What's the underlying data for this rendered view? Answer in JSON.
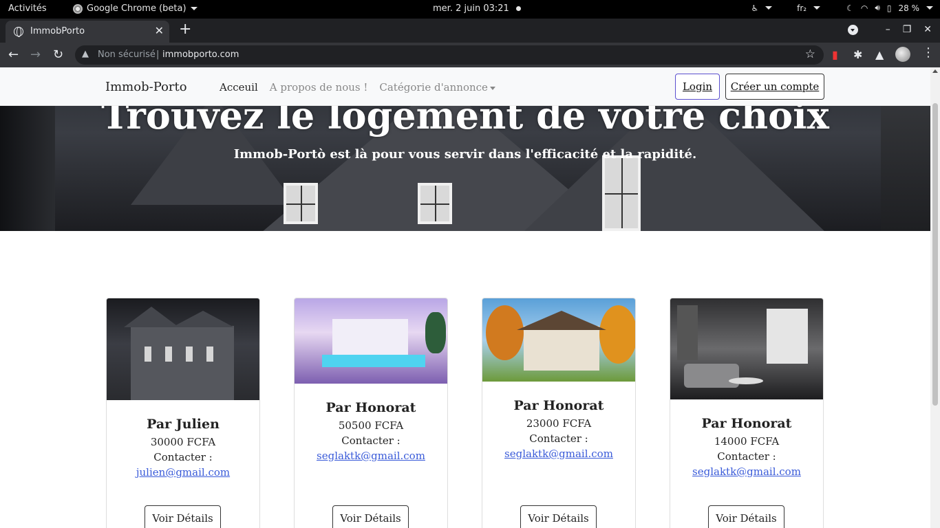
{
  "os": {
    "activities": "Activités",
    "app_name": "Google Chrome (beta)",
    "clock": "mer. 2 juin  03:21",
    "keyboard": "fr₂",
    "battery": "28 %"
  },
  "browser": {
    "tab_title": "ImmobPorto",
    "security_label": "Non sécurisé",
    "url": "immobporto.com"
  },
  "site": {
    "brand": "Immob-Porto",
    "nav": {
      "home": "Acceuil",
      "about": "A propos de nous !",
      "category": "Catégorie d'annonce"
    },
    "login": "Login",
    "signup": "Créer un compte",
    "hero_title": "Trouvez le logement de votre choix",
    "hero_subtitle": "Immob-Portò est là pour vous servir dans l'efficacité et la rapidité.",
    "contact_label": "Contacter :",
    "details_label": "Voir Détails",
    "listings": [
      {
        "owner": "Par Julien",
        "price": "30000 FCFA",
        "email": "julien@gmail.com"
      },
      {
        "owner": "Par Honorat",
        "price": "50500 FCFA",
        "email": "seglaktk@gmail.com"
      },
      {
        "owner": "Par Honorat",
        "price": "23000 FCFA",
        "email": "seglaktk@gmail.com"
      },
      {
        "owner": "Par Honorat",
        "price": "14000 FCFA",
        "email": "seglaktk@gmail.com"
      }
    ]
  }
}
